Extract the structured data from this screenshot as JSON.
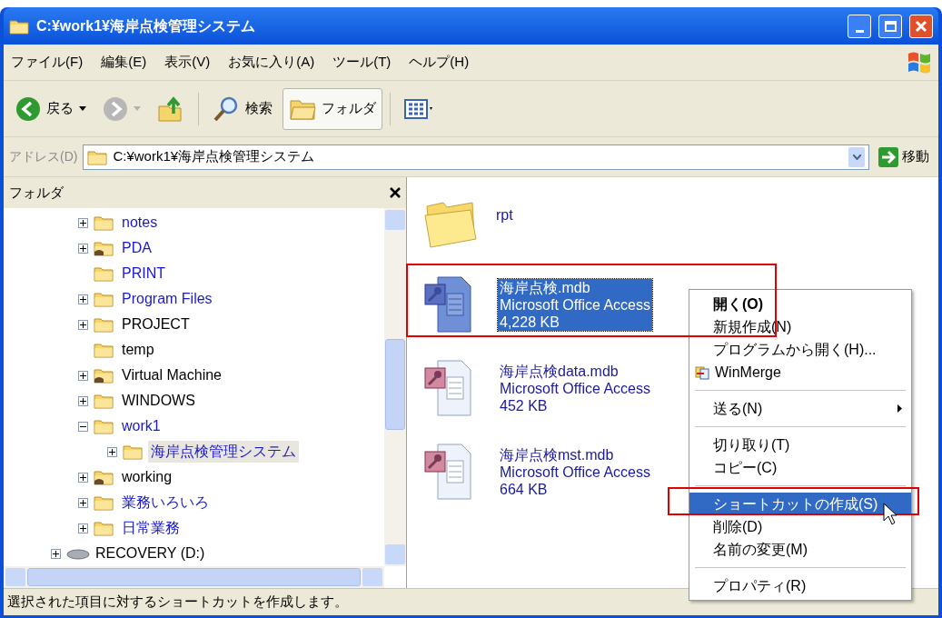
{
  "window": {
    "title": "C:¥work1¥海岸点検管理システム"
  },
  "menu_bar": [
    "ファイル(F)",
    "編集(E)",
    "表示(V)",
    "お気に入り(A)",
    "ツール(T)",
    "ヘルプ(H)"
  ],
  "toolbar": [
    {
      "kind": "back",
      "label": "戻る",
      "disabled": false,
      "pressed": false
    },
    {
      "kind": "forward",
      "disabled": true,
      "pressed": false
    },
    {
      "kind": "up",
      "pressed": false
    },
    {
      "kind": "search",
      "label": "検索",
      "pressed": false
    },
    {
      "kind": "folders",
      "label": "フォルダ",
      "pressed": true
    },
    {
      "kind": "views",
      "pressed": false
    }
  ],
  "address_bar": {
    "label": "アドレス(D)",
    "value": "C:¥work1¥海岸点検管理システム",
    "go": "移動"
  },
  "folder_pane": {
    "title": "フォルダ",
    "tree": [
      {
        "label": "notes",
        "expanded": false,
        "shared": false,
        "compressed": true,
        "selected": false
      },
      {
        "label": "PDA",
        "expanded": false,
        "shared": true,
        "compressed": true,
        "selected": false
      },
      {
        "label": "PRINT",
        "shared": false,
        "compressed": true,
        "selected": false
      },
      {
        "label": "Program Files",
        "expanded": false,
        "shared": false,
        "compressed": true,
        "selected": false
      },
      {
        "label": "PROJECT",
        "expanded": false,
        "shared": false,
        "compressed": false,
        "selected": false
      },
      {
        "label": "temp",
        "shared": false,
        "compressed": false,
        "selected": false
      },
      {
        "label": "Virtual Machine",
        "expanded": false,
        "shared": true,
        "compressed": false,
        "selected": false
      },
      {
        "label": "WINDOWS",
        "expanded": false,
        "shared": false,
        "compressed": false,
        "selected": false
      },
      {
        "label": "work1",
        "expanded": true,
        "shared": false,
        "compressed": true,
        "selected": false,
        "children": [
          {
            "label": "海岸点検管理システム",
            "expanded": false,
            "shared": false,
            "compressed": true,
            "selected": true
          }
        ]
      },
      {
        "label": "working",
        "expanded": false,
        "shared": true,
        "compressed": false,
        "selected": false
      },
      {
        "label": "業務いろいろ",
        "expanded": false,
        "shared": false,
        "compressed": true,
        "selected": false
      },
      {
        "label": "日常業務",
        "expanded": false,
        "shared": false,
        "compressed": true,
        "selected": false
      }
    ],
    "drives": [
      {
        "label": "RECOVERY (D:)",
        "expanded": false
      }
    ]
  },
  "files": [
    {
      "kind": "folder",
      "name": "rpt",
      "selected": false
    },
    {
      "kind": "access",
      "name": "海岸点検.mdb",
      "type": "Microsoft Office Access",
      "size": "4,228 KB",
      "selected": true
    },
    {
      "kind": "access",
      "name": "海岸点検data.mdb",
      "type": "Microsoft Office Access",
      "size": "452 KB",
      "selected": false
    },
    {
      "kind": "access",
      "name": "海岸点検mst.mdb",
      "type": "Microsoft Office Access",
      "size": "664 KB",
      "selected": false
    }
  ],
  "context_menu": [
    {
      "kind": "item",
      "label": "開く(O)",
      "default": true,
      "selected": false
    },
    {
      "kind": "item",
      "label": "新規作成(N)",
      "default": false,
      "selected": false
    },
    {
      "kind": "item",
      "label": "プログラムから開く(H)...",
      "default": false,
      "selected": false
    },
    {
      "kind": "icon_item",
      "label": "WinMerge",
      "default": false,
      "selected": false
    },
    {
      "kind": "separator"
    },
    {
      "kind": "submenu",
      "label": "送る(N)",
      "default": false,
      "selected": false
    },
    {
      "kind": "separator"
    },
    {
      "kind": "item",
      "label": "切り取り(T)",
      "default": false,
      "selected": false
    },
    {
      "kind": "item",
      "label": "コピー(C)",
      "default": false,
      "selected": false
    },
    {
      "kind": "separator"
    },
    {
      "kind": "item",
      "label": "ショートカットの作成(S)",
      "default": false,
      "selected": true
    },
    {
      "kind": "item",
      "label": "削除(D)",
      "default": false,
      "selected": false
    },
    {
      "kind": "item",
      "label": "名前の変更(M)",
      "default": false,
      "selected": false
    },
    {
      "kind": "separator"
    },
    {
      "kind": "item",
      "label": "プロパティ(R)",
      "default": false,
      "selected": false
    }
  ],
  "status_bar": "選択された項目に対するショートカットを作成します。"
}
